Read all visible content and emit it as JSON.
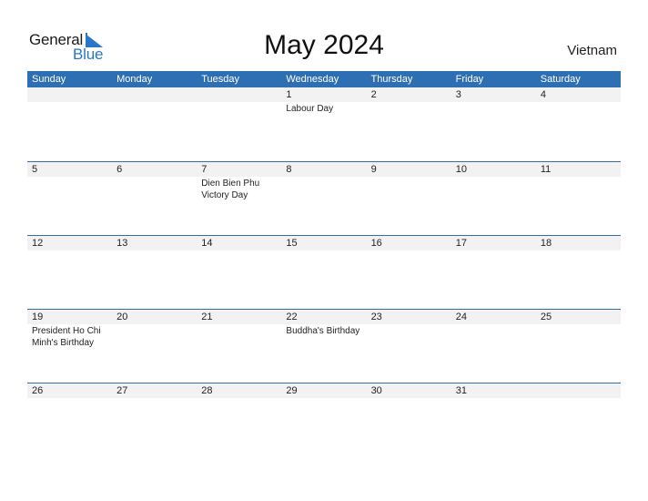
{
  "logo": {
    "word1": "General",
    "word2": "Blue"
  },
  "title": "May 2024",
  "country": "Vietnam",
  "colors": {
    "header_bg": "#2e6fb3",
    "strip_bg": "#f2f2f2",
    "brand_blue": "#2a77c9"
  },
  "weekdays": [
    "Sunday",
    "Monday",
    "Tuesday",
    "Wednesday",
    "Thursday",
    "Friday",
    "Saturday"
  ],
  "weeks": [
    [
      {
        "day": "",
        "holiday": ""
      },
      {
        "day": "",
        "holiday": ""
      },
      {
        "day": "",
        "holiday": ""
      },
      {
        "day": "1",
        "holiday": "Labour Day"
      },
      {
        "day": "2",
        "holiday": ""
      },
      {
        "day": "3",
        "holiday": ""
      },
      {
        "day": "4",
        "holiday": ""
      }
    ],
    [
      {
        "day": "5",
        "holiday": ""
      },
      {
        "day": "6",
        "holiday": ""
      },
      {
        "day": "7",
        "holiday": "Dien Bien Phu Victory Day"
      },
      {
        "day": "8",
        "holiday": ""
      },
      {
        "day": "9",
        "holiday": ""
      },
      {
        "day": "10",
        "holiday": ""
      },
      {
        "day": "11",
        "holiday": ""
      }
    ],
    [
      {
        "day": "12",
        "holiday": ""
      },
      {
        "day": "13",
        "holiday": ""
      },
      {
        "day": "14",
        "holiday": ""
      },
      {
        "day": "15",
        "holiday": ""
      },
      {
        "day": "16",
        "holiday": ""
      },
      {
        "day": "17",
        "holiday": ""
      },
      {
        "day": "18",
        "holiday": ""
      }
    ],
    [
      {
        "day": "19",
        "holiday": "President Ho Chi Minh's Birthday"
      },
      {
        "day": "20",
        "holiday": ""
      },
      {
        "day": "21",
        "holiday": ""
      },
      {
        "day": "22",
        "holiday": "Buddha's Birthday"
      },
      {
        "day": "23",
        "holiday": ""
      },
      {
        "day": "24",
        "holiday": ""
      },
      {
        "day": "25",
        "holiday": ""
      }
    ],
    [
      {
        "day": "26",
        "holiday": ""
      },
      {
        "day": "27",
        "holiday": ""
      },
      {
        "day": "28",
        "holiday": ""
      },
      {
        "day": "29",
        "holiday": ""
      },
      {
        "day": "30",
        "holiday": ""
      },
      {
        "day": "31",
        "holiday": ""
      },
      {
        "day": "",
        "holiday": ""
      }
    ]
  ]
}
